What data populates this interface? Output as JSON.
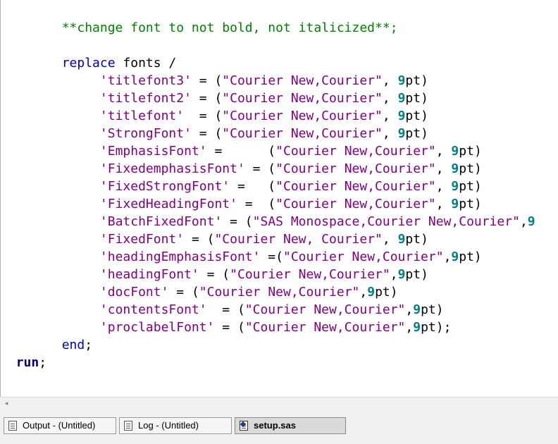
{
  "editor": {
    "lines": [
      [
        {
          "text": "        ",
          "type": "plain"
        },
        {
          "text": "**change font to not bold, not italicized**;",
          "type": "comment"
        }
      ],
      [],
      [
        {
          "text": "        ",
          "type": "plain"
        },
        {
          "text": "replace",
          "type": "keyword"
        },
        {
          "text": " fonts /",
          "type": "plain"
        }
      ],
      [
        {
          "text": "             ",
          "type": "plain"
        },
        {
          "text": "'titlefont3'",
          "type": "string"
        },
        {
          "text": " = (",
          "type": "plain"
        },
        {
          "text": "\"Courier New,Courier\"",
          "type": "string"
        },
        {
          "text": ", ",
          "type": "plain"
        },
        {
          "text": "9",
          "type": "number"
        },
        {
          "text": "pt)",
          "type": "plain"
        }
      ],
      [
        {
          "text": "             ",
          "type": "plain"
        },
        {
          "text": "'titlefont2'",
          "type": "string"
        },
        {
          "text": " = (",
          "type": "plain"
        },
        {
          "text": "\"Courier New,Courier\"",
          "type": "string"
        },
        {
          "text": ", ",
          "type": "plain"
        },
        {
          "text": "9",
          "type": "number"
        },
        {
          "text": "pt)",
          "type": "plain"
        }
      ],
      [
        {
          "text": "             ",
          "type": "plain"
        },
        {
          "text": "'titlefont'",
          "type": "string"
        },
        {
          "text": "  = (",
          "type": "plain"
        },
        {
          "text": "\"Courier New,Courier\"",
          "type": "string"
        },
        {
          "text": ", ",
          "type": "plain"
        },
        {
          "text": "9",
          "type": "number"
        },
        {
          "text": "pt)",
          "type": "plain"
        }
      ],
      [
        {
          "text": "             ",
          "type": "plain"
        },
        {
          "text": "'StrongFont'",
          "type": "string"
        },
        {
          "text": " = (",
          "type": "plain"
        },
        {
          "text": "\"Courier New,Courier\"",
          "type": "string"
        },
        {
          "text": ", ",
          "type": "plain"
        },
        {
          "text": "9",
          "type": "number"
        },
        {
          "text": "pt)",
          "type": "plain"
        }
      ],
      [
        {
          "text": "             ",
          "type": "plain"
        },
        {
          "text": "'EmphasisFont'",
          "type": "string"
        },
        {
          "text": " =      (",
          "type": "plain"
        },
        {
          "text": "\"Courier New,Courier\"",
          "type": "string"
        },
        {
          "text": ", ",
          "type": "plain"
        },
        {
          "text": "9",
          "type": "number"
        },
        {
          "text": "pt)",
          "type": "plain"
        }
      ],
      [
        {
          "text": "             ",
          "type": "plain"
        },
        {
          "text": "'FixedemphasisFont'",
          "type": "string"
        },
        {
          "text": " = (",
          "type": "plain"
        },
        {
          "text": "\"Courier New,Courier\"",
          "type": "string"
        },
        {
          "text": ", ",
          "type": "plain"
        },
        {
          "text": "9",
          "type": "number"
        },
        {
          "text": "pt)",
          "type": "plain"
        }
      ],
      [
        {
          "text": "             ",
          "type": "plain"
        },
        {
          "text": "'FixedStrongFont'",
          "type": "string"
        },
        {
          "text": " =   (",
          "type": "plain"
        },
        {
          "text": "\"Courier New,Courier\"",
          "type": "string"
        },
        {
          "text": ", ",
          "type": "plain"
        },
        {
          "text": "9",
          "type": "number"
        },
        {
          "text": "pt)",
          "type": "plain"
        }
      ],
      [
        {
          "text": "             ",
          "type": "plain"
        },
        {
          "text": "'FixedHeadingFont'",
          "type": "string"
        },
        {
          "text": " =  (",
          "type": "plain"
        },
        {
          "text": "\"Courier New,Courier\"",
          "type": "string"
        },
        {
          "text": ", ",
          "type": "plain"
        },
        {
          "text": "9",
          "type": "number"
        },
        {
          "text": "pt)",
          "type": "plain"
        }
      ],
      [
        {
          "text": "             ",
          "type": "plain"
        },
        {
          "text": "'BatchFixedFont'",
          "type": "string"
        },
        {
          "text": " = (",
          "type": "plain"
        },
        {
          "text": "\"SAS Monospace,Courier New,Courier\"",
          "type": "string"
        },
        {
          "text": ",",
          "type": "plain"
        },
        {
          "text": "9",
          "type": "number"
        }
      ],
      [
        {
          "text": "             ",
          "type": "plain"
        },
        {
          "text": "'FixedFont'",
          "type": "string"
        },
        {
          "text": " = (",
          "type": "plain"
        },
        {
          "text": "\"Courier New, Courier\"",
          "type": "string"
        },
        {
          "text": ", ",
          "type": "plain"
        },
        {
          "text": "9",
          "type": "number"
        },
        {
          "text": "pt)",
          "type": "plain"
        }
      ],
      [
        {
          "text": "             ",
          "type": "plain"
        },
        {
          "text": "'headingEmphasisFont'",
          "type": "string"
        },
        {
          "text": " =(",
          "type": "plain"
        },
        {
          "text": "\"Courier New,Courier\"",
          "type": "string"
        },
        {
          "text": ",",
          "type": "plain"
        },
        {
          "text": "9",
          "type": "number"
        },
        {
          "text": "pt)",
          "type": "plain"
        }
      ],
      [
        {
          "text": "             ",
          "type": "plain"
        },
        {
          "text": "'headingFont'",
          "type": "string"
        },
        {
          "text": " = (",
          "type": "plain"
        },
        {
          "text": "\"Courier New,Courier\"",
          "type": "string"
        },
        {
          "text": ",",
          "type": "plain"
        },
        {
          "text": "9",
          "type": "number"
        },
        {
          "text": "pt)",
          "type": "plain"
        }
      ],
      [
        {
          "text": "             ",
          "type": "plain"
        },
        {
          "text": "'docFont'",
          "type": "string"
        },
        {
          "text": " = (",
          "type": "plain"
        },
        {
          "text": "\"Courier New,Courier\"",
          "type": "string"
        },
        {
          "text": ",",
          "type": "plain"
        },
        {
          "text": "9",
          "type": "number"
        },
        {
          "text": "pt)",
          "type": "plain"
        }
      ],
      [
        {
          "text": "             ",
          "type": "plain"
        },
        {
          "text": "'contentsFont'",
          "type": "string"
        },
        {
          "text": "  = (",
          "type": "plain"
        },
        {
          "text": "\"Courier New,Courier\"",
          "type": "string"
        },
        {
          "text": ",",
          "type": "plain"
        },
        {
          "text": "9",
          "type": "number"
        },
        {
          "text": "pt)",
          "type": "plain"
        }
      ],
      [
        {
          "text": "             ",
          "type": "plain"
        },
        {
          "text": "'proclabelFont'",
          "type": "string"
        },
        {
          "text": " = (",
          "type": "plain"
        },
        {
          "text": "\"Courier New,Courier\"",
          "type": "string"
        },
        {
          "text": ",",
          "type": "plain"
        },
        {
          "text": "9",
          "type": "number"
        },
        {
          "text": "pt);",
          "type": "plain"
        }
      ],
      [
        {
          "text": "        ",
          "type": "plain"
        },
        {
          "text": "end",
          "type": "keyword"
        },
        {
          "text": ";",
          "type": "plain"
        }
      ],
      [
        {
          "text": "  ",
          "type": "plain"
        },
        {
          "text": "run",
          "type": "bold"
        },
        {
          "text": ";",
          "type": "plain"
        }
      ]
    ]
  },
  "taskbar": {
    "tabs": [
      {
        "label": "Output - (Untitled)",
        "icon": "document-icon",
        "active": false
      },
      {
        "label": "Log - (Untitled)",
        "icon": "document-icon",
        "active": false
      },
      {
        "label": "setup.sas",
        "icon": "program-icon",
        "active": true
      }
    ]
  },
  "hscroll": {
    "left_arrow": "◂"
  }
}
